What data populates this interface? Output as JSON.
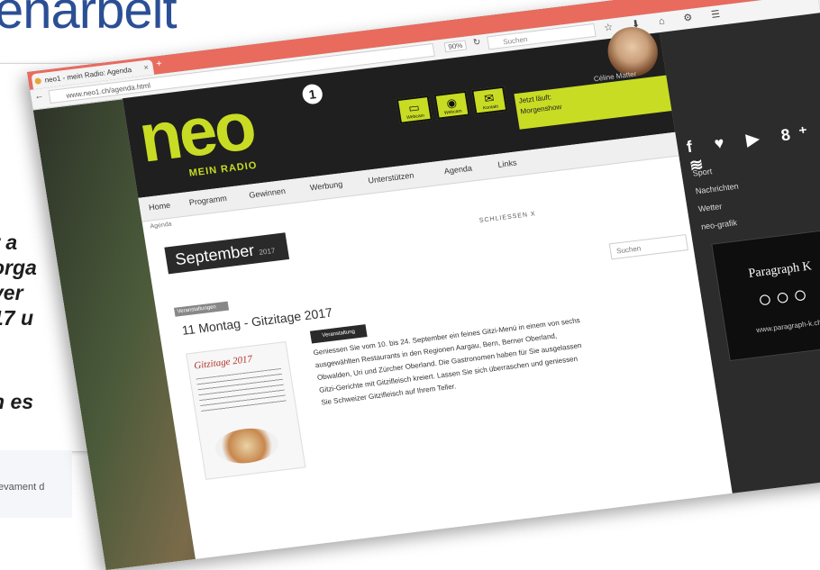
{
  "slide": {
    "title": "enarbeit",
    "doc_lines": [
      "r a",
      "orga",
      "ver",
      "17 u",
      "n es"
    ],
    "footer": "evament d"
  },
  "browser": {
    "tab_label": "neo1 - mein Radio: Agenda",
    "tab_close": "×",
    "tab_add": "+",
    "url": "www.neo1.ch/agenda.html",
    "zoom": "90%",
    "search_placeholder": "Suchen",
    "back_icon": "back-arrow-icon",
    "toolbar_icons": "☆ ⬇ ⌂ ⚙ ☰"
  },
  "site": {
    "logo": "neo",
    "logo_sup": "1",
    "tagline": "MEIN RADIO",
    "header_icons": [
      {
        "name": "webcam",
        "glyph": "▭",
        "label": "Webcam"
      },
      {
        "name": "camera",
        "glyph": "◉",
        "label": "Webcam"
      },
      {
        "name": "mail",
        "glyph": "✉",
        "label": "Kontakt"
      }
    ],
    "host": {
      "name": "Céline Matter",
      "label": "Jetzt läuft:",
      "show": "Morgenshow"
    },
    "nav": [
      "Home",
      "Programm",
      "Gewinnen",
      "Werbung",
      "Unterstützen",
      "Agenda",
      "Links"
    ],
    "search_label": "Suchen",
    "breadcrumb": "Agenda"
  },
  "content": {
    "month": "September",
    "year": "2017",
    "close_link": "SCHLIESSEN X",
    "category_tag": "Veranstaltungen",
    "event_title": "11 Montag - Gitzitage 2017",
    "event_badge": "Veranstaltung",
    "event_text": "Geniessen Sie vom 10. bis 24. September ein feines Gitzi-Menü in einem von sechs ausgewählten Restaurants in den Regionen Aargau, Bern, Berner Oberland, Obwalden, Uri und Zürcher Oberland. Die Gastronomen haben für Sie ausgelassen Gitzi-Gerichte mit Gitzifleisch kreiert. Lassen Sie sich überraschen und geniessen Sie Schweizer Gitzifleisch auf Ihrem Teller.",
    "thumb_title": "Gitzitage 2017"
  },
  "sidebar": {
    "social": "f ♥ ▶ 8⁺ ≋",
    "links": [
      "Sport",
      "Nachrichten",
      "Wetter",
      "neo-grafik"
    ],
    "ad": {
      "title": "Paragraph K",
      "dots": "○○○",
      "url": "www.paragraph-k.ch"
    }
  }
}
